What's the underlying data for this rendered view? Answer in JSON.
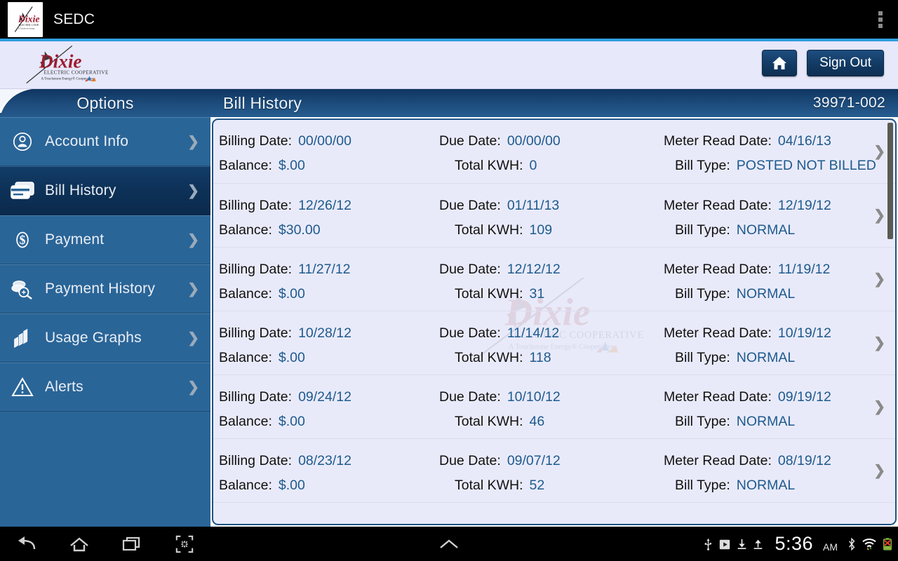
{
  "system_bar": {
    "app_title": "SEDC",
    "overflow_icon": "overflow-menu-icon"
  },
  "app_header": {
    "logo": {
      "name": "Dixie",
      "line1": "ELECTRIC COOPERATIVE",
      "line2": "A Touchstone Energy® Cooperative"
    },
    "home_label": "Home",
    "sign_out_label": "Sign Out"
  },
  "sidebar": {
    "title": "Options",
    "items": [
      {
        "label": "Account Info",
        "icon": "person-circle-icon",
        "selected": false
      },
      {
        "label": "Bill History",
        "icon": "credit-card-icon",
        "selected": true
      },
      {
        "label": "Payment",
        "icon": "dollar-coin-icon",
        "selected": false
      },
      {
        "label": "Payment History",
        "icon": "coins-search-icon",
        "selected": false
      },
      {
        "label": "Usage Graphs",
        "icon": "bar-chart-icon",
        "selected": false
      },
      {
        "label": "Alerts",
        "icon": "warning-triangle-icon",
        "selected": false
      }
    ]
  },
  "content": {
    "title": "Bill History",
    "account_number": "39971-002",
    "labels": {
      "billing_date": "Billing Date:",
      "due_date": "Due Date:",
      "meter_read_date": "Meter Read Date:",
      "balance": "Balance:",
      "total_kwh": "Total KWH:",
      "bill_type": "Bill Type:"
    },
    "rows": [
      {
        "billing_date": "00/00/00",
        "due_date": "00/00/00",
        "meter_read_date": "04/16/13",
        "balance": "$.00",
        "total_kwh": "0",
        "bill_type": "POSTED NOT BILLED"
      },
      {
        "billing_date": "12/26/12",
        "due_date": "01/11/13",
        "meter_read_date": "12/19/12",
        "balance": "$30.00",
        "total_kwh": "109",
        "bill_type": "NORMAL"
      },
      {
        "billing_date": "11/27/12",
        "due_date": "12/12/12",
        "meter_read_date": "11/19/12",
        "balance": "$.00",
        "total_kwh": "31",
        "bill_type": "NORMAL"
      },
      {
        "billing_date": "10/28/12",
        "due_date": "11/14/12",
        "meter_read_date": "10/19/12",
        "balance": "$.00",
        "total_kwh": "118",
        "bill_type": "NORMAL"
      },
      {
        "billing_date": "09/24/12",
        "due_date": "10/10/12",
        "meter_read_date": "09/19/12",
        "balance": "$.00",
        "total_kwh": "46",
        "bill_type": "NORMAL"
      },
      {
        "billing_date": "08/23/12",
        "due_date": "09/07/12",
        "meter_read_date": "08/19/12",
        "balance": "$.00",
        "total_kwh": "52",
        "bill_type": "NORMAL"
      }
    ],
    "row_chevron": "chevron-right-icon"
  },
  "nav_bar": {
    "back_icon": "back-icon",
    "home_icon": "home-icon",
    "recents_icon": "recent-apps-icon",
    "screenshot_icon": "screenshot-icon",
    "expand_icon": "chevron-up-icon",
    "status_icons": [
      "usb-icon",
      "play-store-icon",
      "download-icon",
      "upload-icon",
      "bluetooth-icon",
      "wifi-icon",
      "battery-error-icon"
    ],
    "clock": "5:36",
    "clock_ampm": "AM"
  },
  "colors": {
    "accent_blue": "#2e9fe0",
    "header_navy": "#0f3560",
    "sidebar_blue": "#2a6598",
    "selected_navy": "#0d3157",
    "panel_lavender": "#e9eaf9",
    "value_blue": "#1d5a8e"
  }
}
